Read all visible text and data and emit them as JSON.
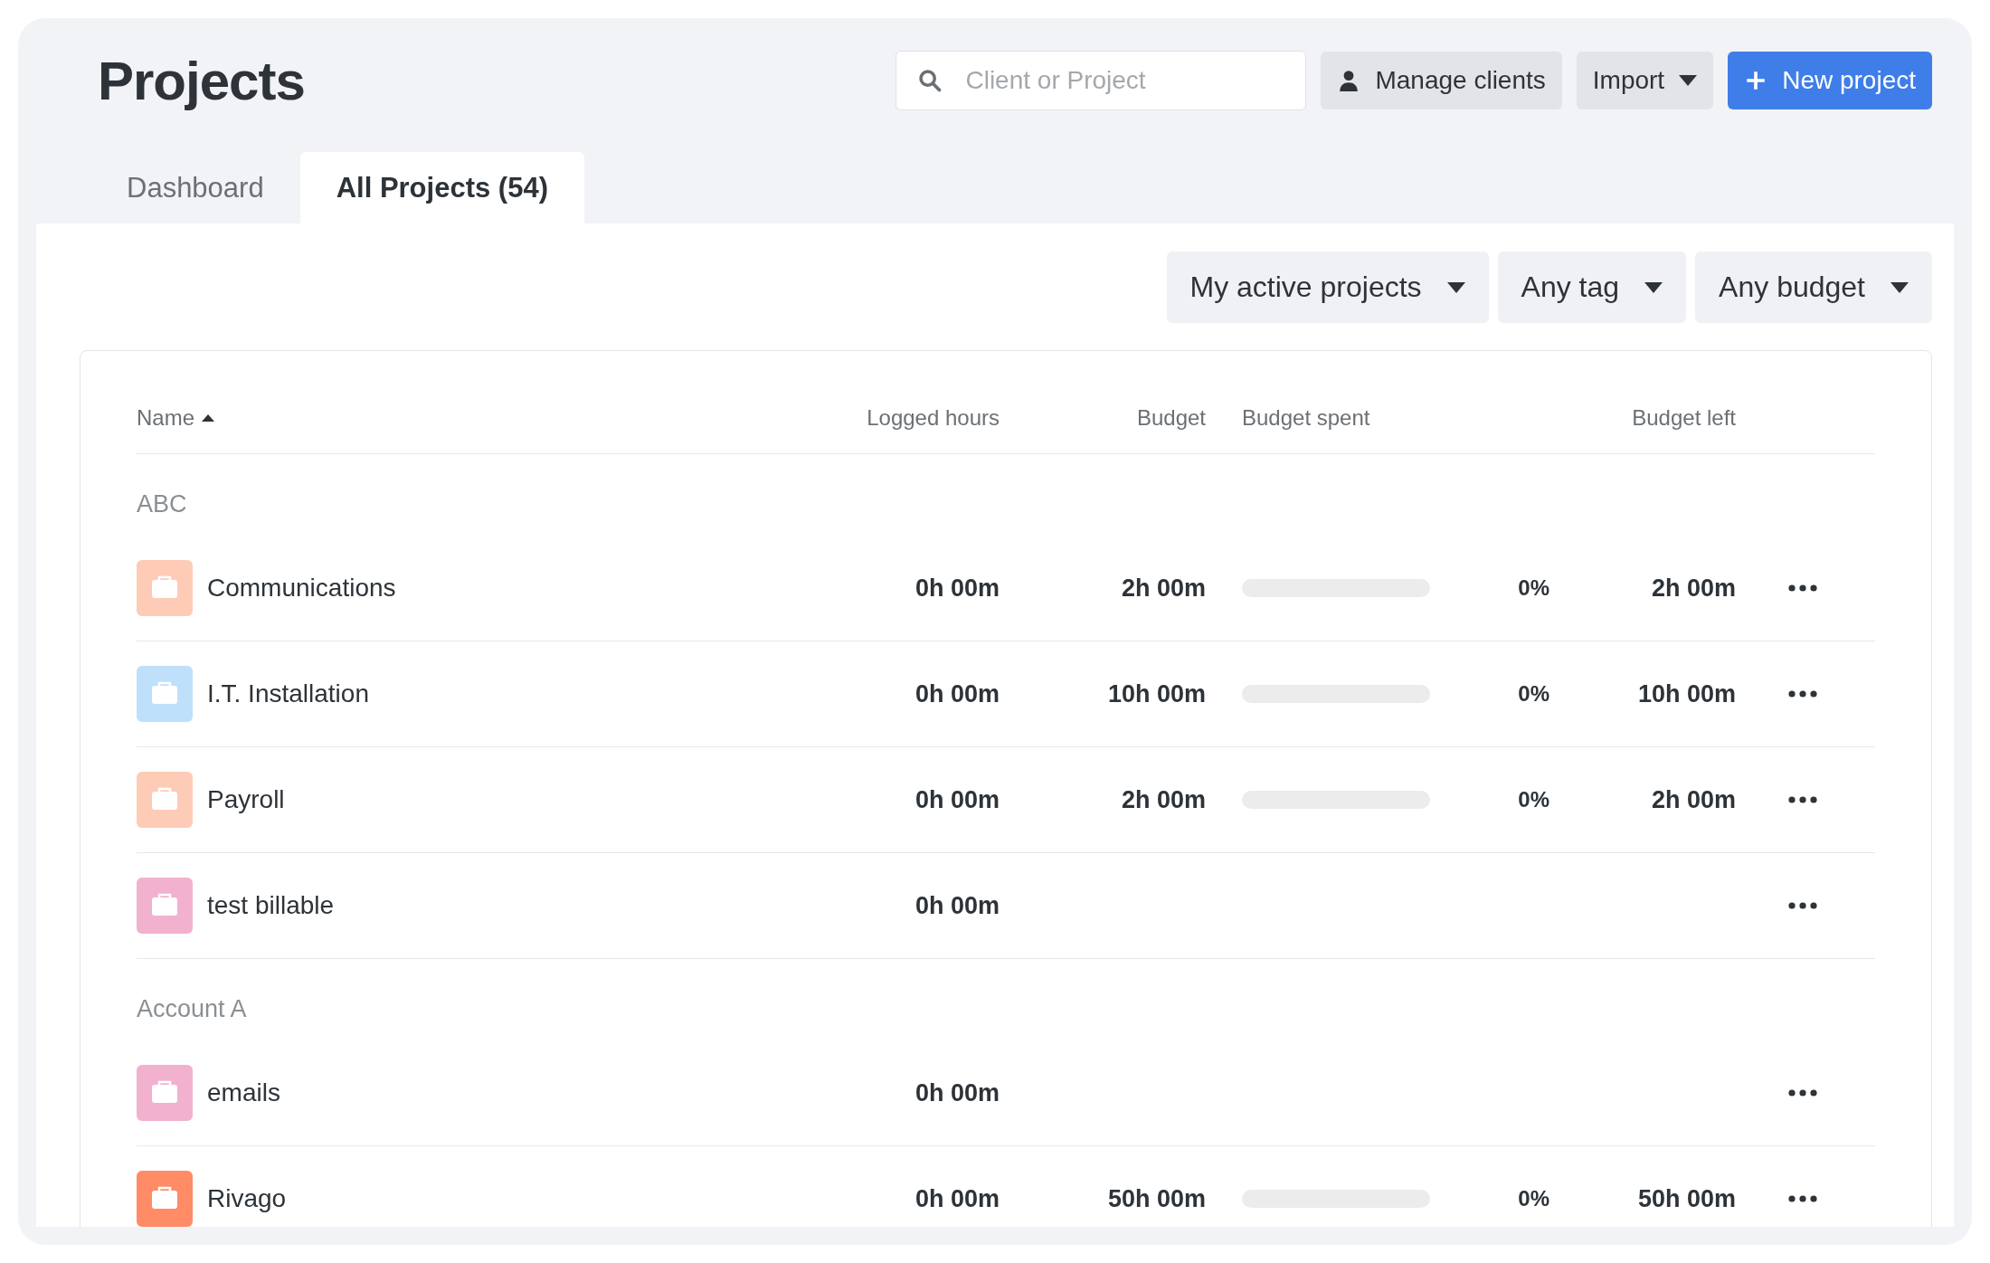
{
  "page": {
    "title": "Projects"
  },
  "search": {
    "placeholder": "Client or Project"
  },
  "header_buttons": [
    {
      "label": "Manage clients",
      "kind": "person"
    },
    {
      "label": "Import",
      "kind": "dropdown"
    },
    {
      "label": "New project",
      "kind": "primary"
    }
  ],
  "tabs": [
    {
      "label": "Dashboard",
      "selected": false
    },
    {
      "label": "All Projects (54)",
      "selected": true
    }
  ],
  "filters": [
    "My active projects",
    "Any tag",
    "Any budget"
  ],
  "table": {
    "columns": [
      {
        "label": "Name",
        "sorted": true
      },
      {
        "label": "Logged hours"
      },
      {
        "label": "Budget"
      },
      {
        "label": "Budget spent"
      },
      {
        "label": "Budget left"
      }
    ],
    "groups": [
      {
        "name": "ABC",
        "projects": [
          {
            "name": "Communications",
            "color": "#fecbb7",
            "logged": "0h 00m",
            "budget": "2h 00m",
            "spent": {
              "level": 0,
              "percent": "0%"
            },
            "left": "2h 00m"
          },
          {
            "name": "I.T. Installation",
            "color": "#bfe0fb",
            "logged": "0h 00m",
            "budget": "10h 00m",
            "spent": {
              "level": 0,
              "percent": "0%"
            },
            "left": "10h 00m"
          },
          {
            "name": "Payroll",
            "color": "#fecbb7",
            "logged": "0h 00m",
            "budget": "2h 00m",
            "spent": {
              "level": 0,
              "percent": "0%"
            },
            "left": "2h 00m"
          },
          {
            "name": "test billable",
            "color": "#f2b1cf",
            "logged": "0h 00m"
          }
        ]
      },
      {
        "name": "Account A",
        "projects": [
          {
            "name": "emails",
            "color": "#f2b1cf",
            "logged": "0h 00m"
          },
          {
            "name": "Rivago",
            "color": "#ff8c66",
            "logged": "0h 00m",
            "budget": "50h 00m",
            "spent": {
              "level": 0,
              "percent": "0%"
            },
            "left": "50h 00m"
          }
        ]
      }
    ]
  }
}
